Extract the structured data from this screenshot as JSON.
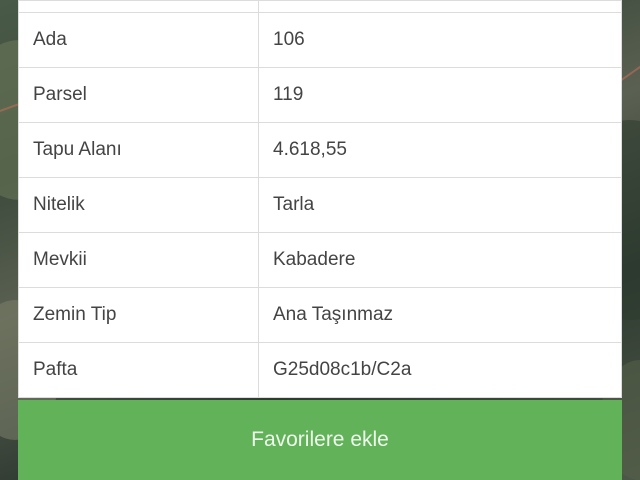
{
  "parcel_info": {
    "rows": [
      {
        "label": "Ada",
        "value": "106"
      },
      {
        "label": "Parsel",
        "value": "119"
      },
      {
        "label": "Tapu Alanı",
        "value": "4.618,55"
      },
      {
        "label": "Nitelik",
        "value": "Tarla"
      },
      {
        "label": "Mevkii",
        "value": "Kabadere"
      },
      {
        "label": "Zemin Tip",
        "value": "Ana Taşınmaz"
      },
      {
        "label": "Pafta",
        "value": "G25d08c1b/C2a"
      }
    ]
  },
  "actions": {
    "favorite_label": "Favorilere ekle"
  },
  "colors": {
    "button_green": "#62b25a",
    "table_border": "#dcdcdc",
    "text": "#444444"
  }
}
